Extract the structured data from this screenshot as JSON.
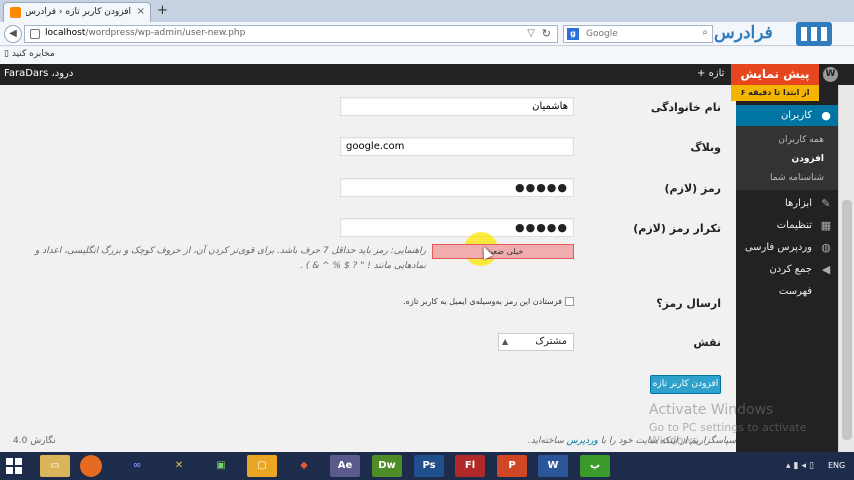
{
  "browser": {
    "tab_title": "افزودن کاربر تازه ‹ فرادرس — ...",
    "tab_close": "×",
    "new_tab": "+",
    "url_host": "localhost",
    "url_path": "/wordpress/wp-admin/user-new.php",
    "search_placeholder": "Google",
    "bookmark": "مخابره کنید",
    "logo_text": "فرادرس"
  },
  "adminbar": {
    "howdy": "FaraDars ،درود",
    "new_label": "+ تازه"
  },
  "promo": {
    "title": "پیش نمایش",
    "subtitle": "از ابتدا تا دقیقه ۶"
  },
  "sidebar": {
    "users": "کاربران",
    "submenu": [
      "همه کاربران",
      "افزودن",
      "شناسنامه شما"
    ],
    "tools": "ابزارها",
    "settings": "تنظیمات",
    "persian": "وردپرس فارسی",
    "collapse": "جمع کردن فهرست"
  },
  "form": {
    "last_name_label": "نام خانوادگی",
    "last_name_value": "هاشمیان",
    "website_label": "وبلاگ",
    "website_value": "google.com",
    "password_label": "رمز (لازم)",
    "password_value": "●●●●●",
    "password_repeat_label": "تکرار رمز (لازم)",
    "password_repeat_value": "●●●●●",
    "strength": "خیلی ضعیف",
    "hint_line1": "راهنمایی: رمز باید حداقل 7 حرف باشد. برای قوی‌تر کردن آن، از حروف کوچک و بزرگ انگلیسی، اعداد و",
    "hint_line2": "نمادهایی مانند ! \" ? $ % ^ & ) .",
    "send_password_label": "ارسال رمز؟",
    "send_password_text": "فرستادن این رمز به‌وسیله‌ی ایمیل به کاربر تازه.",
    "role_label": "نقش",
    "role_value": "مشترک",
    "submit": "افزودن کاربر تازه"
  },
  "footer": {
    "thanks_prefix": "سپاسگزاریم از اینکه سایت خود را با ",
    "thanks_link": "وردپرس",
    "thanks_suffix": " ساخته‌اید.",
    "version": "نگارش 4.0"
  },
  "watermark": {
    "line1": "Activate Windows",
    "line2": "Go to PC settings to activate Windows."
  },
  "taskbar": {
    "lang": "ENG",
    "apps": [
      "Ae",
      "Dw",
      "Ps",
      "Fl",
      "P",
      "W",
      "پ"
    ]
  },
  "colors": {
    "wp_blue": "#0074a2",
    "promo_red": "#e8461e",
    "promo_yellow": "#f4b400",
    "strength_bad": "#f1adad"
  }
}
